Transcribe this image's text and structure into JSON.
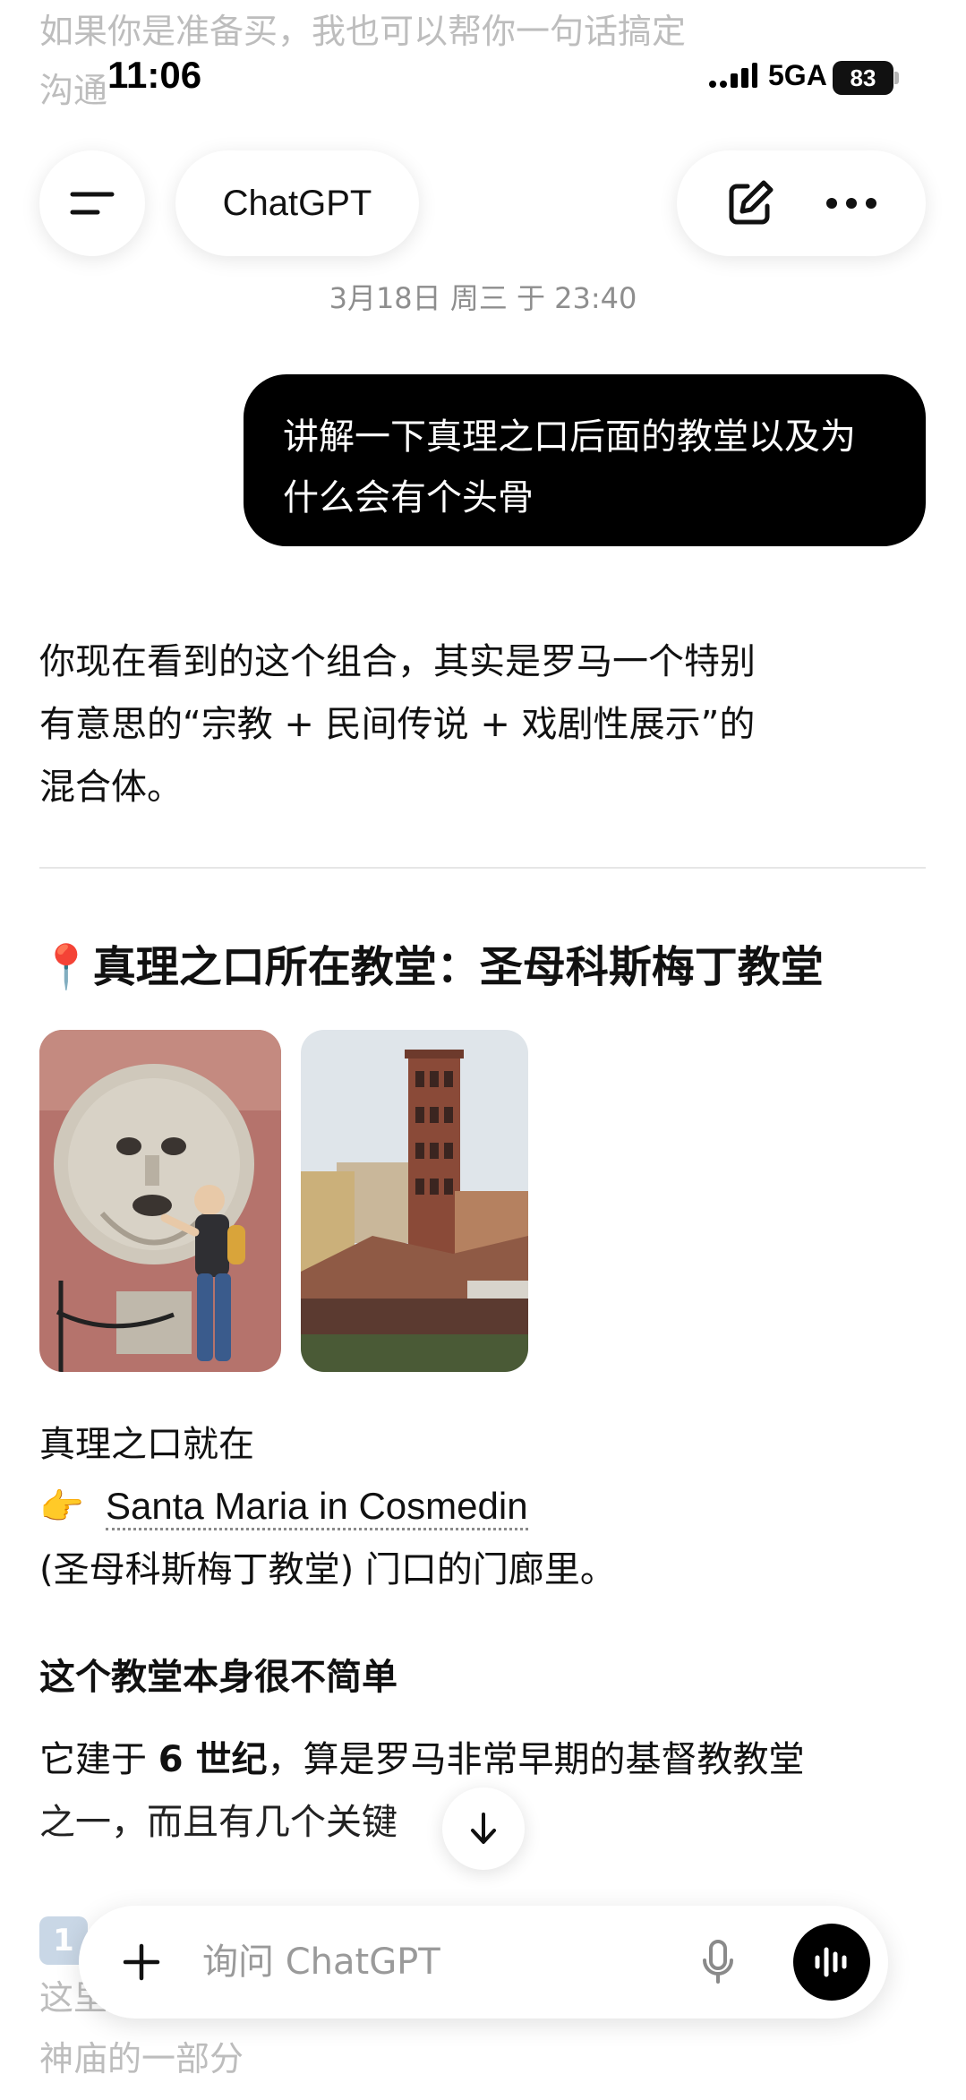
{
  "previous_message": {
    "line1": "如果你是准备买，我也可以帮你一句话搞定",
    "line2": "沟通"
  },
  "status_bar": {
    "time": "11:06",
    "network": "5GA",
    "battery": "83"
  },
  "header": {
    "model_name": "ChatGPT",
    "icons": [
      "menu-icon",
      "new-chat-icon",
      "more-icon"
    ]
  },
  "timestamp": "3月18日 周三 于 23:40",
  "user_message": "讲解一下真理之口后面的教堂以及为什么会有个头骨",
  "assistant": {
    "intro_line1": "你现在看到的这个组合，其实是罗马一个特别",
    "intro_line2": "有意思的“宗教 + 民间传说 + 戏剧性展示”的",
    "intro_line3": "混合体。",
    "section_pin": "📍",
    "section_heading": "真理之口所在教堂：圣母科斯梅丁教堂",
    "location_line1": "真理之口就在",
    "pointing_emoji": "👉",
    "church_link": "Santa Maria in Cosmedin",
    "location_line3": "(圣母科斯梅丁教堂) 门口的门廊里。",
    "sub_heading": "这个教堂本身很不简单",
    "desc_line1_pre": "它建于 ",
    "desc_line1_bold": "6 世纪",
    "desc_line1_post": "，算是罗马非常早期的基督教教堂",
    "desc_line2": "之一，而且有几个关键",
    "list_badge": "1",
    "faded_line1": "这里",
    "faded_line2": "神庙的一部分"
  },
  "composer": {
    "placeholder": "询问 ChatGPT"
  },
  "colors": {
    "bubble": "#000000",
    "muted": "#8e8e8e",
    "faded": "#bdbdbd"
  }
}
